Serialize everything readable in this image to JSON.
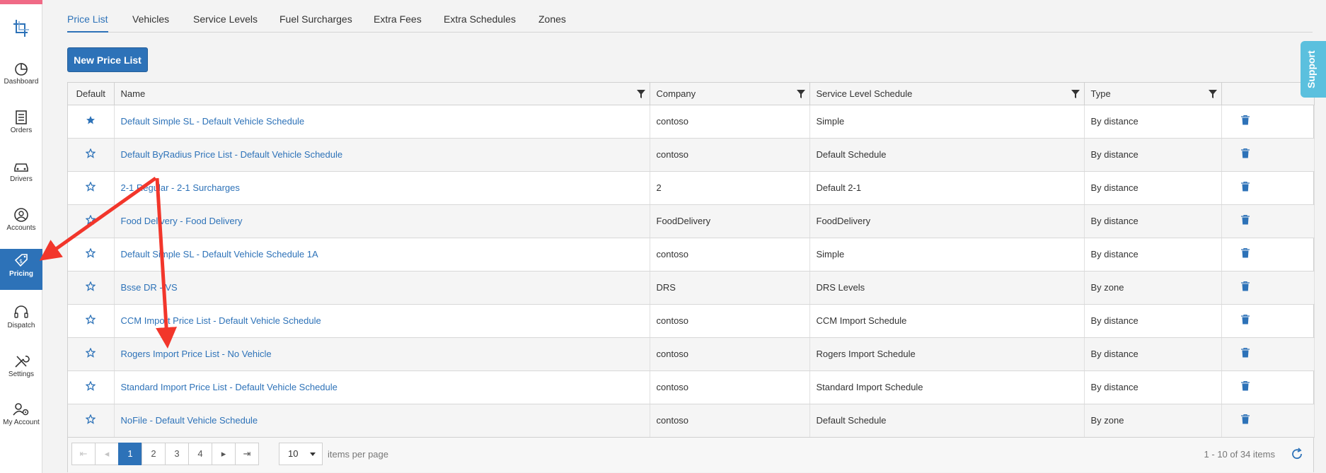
{
  "nav": [
    {
      "label": "Dashboard",
      "icon": "dashboard-icon"
    },
    {
      "label": "Orders",
      "icon": "orders-icon"
    },
    {
      "label": "Drivers",
      "icon": "car-icon"
    },
    {
      "label": "Accounts",
      "icon": "user-circle-icon"
    },
    {
      "label": "Pricing",
      "icon": "price-tag-icon",
      "active": true
    },
    {
      "label": "Dispatch",
      "icon": "headset-icon"
    },
    {
      "label": "Settings",
      "icon": "tools-icon"
    },
    {
      "label": "My Account",
      "icon": "user-gear-icon"
    }
  ],
  "tabs": [
    "Price List",
    "Vehicles",
    "Service Levels",
    "Fuel Surcharges",
    "Extra Fees",
    "Extra Schedules",
    "Zones"
  ],
  "new_button": "New Price List",
  "columns": [
    "Default",
    "Name",
    "Company",
    "Service Level Schedule",
    "Type"
  ],
  "rows": [
    {
      "default": true,
      "name": "Default Simple SL - Default Vehicle Schedule",
      "company": "contoso",
      "schedule": "Simple",
      "type": "By distance"
    },
    {
      "default": false,
      "name": "Default ByRadius Price List - Default Vehicle Schedule",
      "company": "contoso",
      "schedule": "Default Schedule",
      "type": "By distance"
    },
    {
      "default": false,
      "name": "2-1 Regular - 2-1 Surcharges",
      "company": "2",
      "schedule": "Default 2-1",
      "type": "By distance"
    },
    {
      "default": false,
      "name": "Food Delivery - Food Delivery",
      "company": "FoodDelivery",
      "schedule": "FoodDelivery",
      "type": "By distance"
    },
    {
      "default": false,
      "name": "Default Simple SL - Default Vehicle Schedule 1A",
      "company": "contoso",
      "schedule": "Simple",
      "type": "By distance"
    },
    {
      "default": false,
      "name": "Bsse DR - VS",
      "company": "DRS",
      "schedule": "DRS Levels",
      "type": "By zone"
    },
    {
      "default": false,
      "name": "CCM Import Price List - Default Vehicle Schedule",
      "company": "contoso",
      "schedule": "CCM Import Schedule",
      "type": "By distance"
    },
    {
      "default": false,
      "name": "Rogers Import Price List - No Vehicle",
      "company": "contoso",
      "schedule": "Rogers Import Schedule",
      "type": "By distance"
    },
    {
      "default": false,
      "name": "Standard Import Price List - Default Vehicle Schedule",
      "company": "contoso",
      "schedule": "Standard Import Schedule",
      "type": "By distance"
    },
    {
      "default": false,
      "name": "NoFile - Default Vehicle Schedule",
      "company": "contoso",
      "schedule": "Default Schedule",
      "type": "By zone"
    }
  ],
  "pager": {
    "pages": [
      "1",
      "2",
      "3",
      "4"
    ],
    "current": "1",
    "per_page": "10",
    "per_page_label": "items per page",
    "range": "1 - 10 of 34 items"
  },
  "support_label": "Support",
  "colors": {
    "accent": "#2d72b8",
    "annotation": "#f2362b",
    "support": "#5bc0de"
  }
}
